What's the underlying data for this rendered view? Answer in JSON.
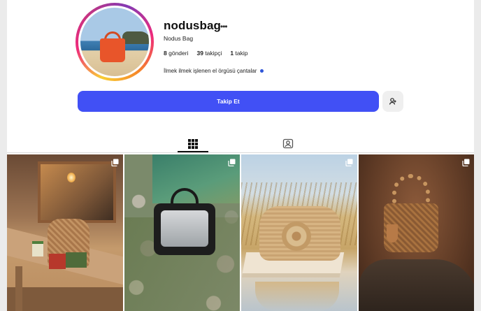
{
  "profile": {
    "username": "nodusbag",
    "more_icon": "more-horizontal-icon",
    "full_name": "Nodus Bag",
    "stats": {
      "posts_count": "8",
      "posts_label": "gönderi",
      "followers_count": "39",
      "followers_label": "takipçi",
      "following_count": "1",
      "following_label": "takip"
    },
    "bio": "İlmek ilmek işlenen el örgüsü çantalar",
    "story_ring_colors": [
      "#f9ce34",
      "#ee2a7b",
      "#833ab4"
    ]
  },
  "actions": {
    "follow_label": "Takip Et",
    "follow_color": "#4150f5",
    "suggest_icon": "add-user-icon"
  },
  "tabs": [
    {
      "icon": "grid-icon",
      "active": true
    },
    {
      "icon": "tagged-icon",
      "active": false
    }
  ],
  "posts": [
    {
      "subject": "crochet-bag-on-bench",
      "multi": true
    },
    {
      "subject": "black-bag-on-stones",
      "multi": true
    },
    {
      "subject": "beige-bag-in-wheat-field",
      "multi": true
    },
    {
      "subject": "brown-bag-with-bead-handle",
      "multi": true
    }
  ]
}
